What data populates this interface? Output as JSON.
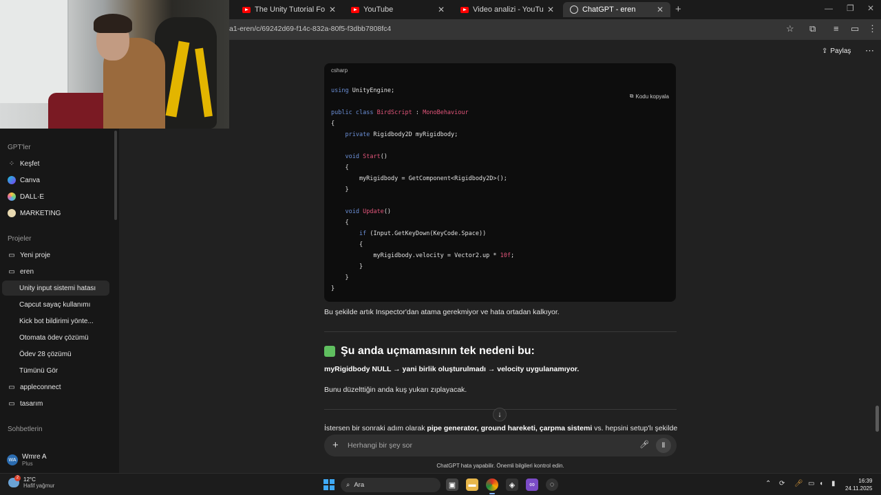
{
  "browser": {
    "tabs": [
      {
        "title": "The Unity Tutorial For Complete",
        "icon": "youtube-icon"
      },
      {
        "title": "YouTube",
        "icon": "youtube-icon"
      },
      {
        "title": "Video analizi - YouTube Studio",
        "icon": "youtube-icon"
      },
      {
        "title": "ChatGPT - eren",
        "icon": "chatgpt-icon"
      }
    ],
    "url": "a1-eren/c/69242d69-f14c-832a-80f5-f3dbb7808fc4"
  },
  "sidebar": {
    "gpts_title": "GPT'ler",
    "gpts": [
      {
        "label": "Keşfet"
      },
      {
        "label": "Canva"
      },
      {
        "label": "DALL·E"
      },
      {
        "label": "MARKETING"
      }
    ],
    "projects_title": "Projeler",
    "projects": [
      {
        "label": "Yeni proje"
      },
      {
        "label": "eren"
      },
      {
        "label": "Unity input sistemi hatası"
      },
      {
        "label": "Capcut sayaç kullanımı"
      },
      {
        "label": "Kick bot bildirimi yönte..."
      },
      {
        "label": "Otomata ödev çözümü"
      },
      {
        "label": "Ödev 28 çözümü"
      },
      {
        "label": "Tümünü Gör"
      },
      {
        "label": "appleconnect"
      },
      {
        "label": "tasarım"
      }
    ],
    "chats_title": "Sohbetlerin",
    "profile": {
      "initials": "WA",
      "name": "Wmre A",
      "plan": "Plus"
    }
  },
  "header": {
    "share_label": "Paylaş"
  },
  "code": {
    "language": "csharp",
    "copy_label": "Kodu kopyala",
    "lines": [
      {
        "parts": [
          {
            "t": "using",
            "c": "kw"
          },
          {
            "t": " UnityEngine;",
            "c": ""
          }
        ]
      },
      {
        "parts": []
      },
      {
        "parts": [
          {
            "t": "public",
            "c": "kw"
          },
          {
            "t": " ",
            "c": ""
          },
          {
            "t": "class",
            "c": "kw"
          },
          {
            "t": " ",
            "c": ""
          },
          {
            "t": "BirdScript",
            "c": "cls"
          },
          {
            "t": " : ",
            "c": ""
          },
          {
            "t": "MonoBehaviour",
            "c": "cls"
          }
        ]
      },
      {
        "parts": [
          {
            "t": "{",
            "c": ""
          }
        ]
      },
      {
        "parts": [
          {
            "t": "    ",
            "c": ""
          },
          {
            "t": "private",
            "c": "kw"
          },
          {
            "t": " Rigidbody2D myRigidbody;",
            "c": ""
          }
        ]
      },
      {
        "parts": []
      },
      {
        "parts": [
          {
            "t": "    ",
            "c": ""
          },
          {
            "t": "void",
            "c": "kw"
          },
          {
            "t": " ",
            "c": ""
          },
          {
            "t": "Start",
            "c": "cls"
          },
          {
            "t": "()",
            "c": ""
          }
        ]
      },
      {
        "parts": [
          {
            "t": "    {",
            "c": ""
          }
        ]
      },
      {
        "parts": [
          {
            "t": "        myRigidbody = GetComponent<Rigidbody2D>();",
            "c": ""
          }
        ]
      },
      {
        "parts": [
          {
            "t": "    }",
            "c": ""
          }
        ]
      },
      {
        "parts": []
      },
      {
        "parts": [
          {
            "t": "    ",
            "c": ""
          },
          {
            "t": "void",
            "c": "kw"
          },
          {
            "t": " ",
            "c": ""
          },
          {
            "t": "Update",
            "c": "cls"
          },
          {
            "t": "()",
            "c": ""
          }
        ]
      },
      {
        "parts": [
          {
            "t": "    {",
            "c": ""
          }
        ]
      },
      {
        "parts": [
          {
            "t": "        ",
            "c": ""
          },
          {
            "t": "if",
            "c": "kw"
          },
          {
            "t": " (Input.GetKeyDown(KeyCode.Space))",
            "c": ""
          }
        ]
      },
      {
        "parts": [
          {
            "t": "        {",
            "c": ""
          }
        ]
      },
      {
        "parts": [
          {
            "t": "            myRigidbody.velocity = Vector2.up * ",
            "c": ""
          },
          {
            "t": "10f",
            "c": "num"
          },
          {
            "t": ";",
            "c": ""
          }
        ]
      },
      {
        "parts": [
          {
            "t": "        }",
            "c": ""
          }
        ]
      },
      {
        "parts": [
          {
            "t": "    }",
            "c": ""
          }
        ]
      },
      {
        "parts": [
          {
            "t": "}",
            "c": ""
          }
        ]
      }
    ]
  },
  "content": {
    "after_code": "Bu şekilde artık Inspector'dan atama gerekmiyor ve hata ortadan kalkıyor.",
    "heading": "Şu anda uçmamasının tek nedeni bu:",
    "bold_line": "myRigidbody NULL → yani birlik oluşturulmadı → velocity uygulanamıyor.",
    "fix_line": "Bunu düzelttiğin anda kuş yukarı zıplayacak.",
    "next_prefix": "İstersen bir sonraki adım olarak ",
    "next_b1": "pipe generator, ground hareketi, çarpma sistemi",
    "next_suffix": " vs. hepsini setup'lı şekilde"
  },
  "composer": {
    "placeholder": "Herhangi bir şey sor",
    "disclaimer": "ChatGPT hata yapabilir. Önemli bilgileri kontrol edin."
  },
  "taskbar": {
    "weather_temp": "12°C",
    "weather_desc": "Hafif yağmur",
    "weather_badge": "2",
    "search_label": "Ara",
    "time": "16:39",
    "date": "24.11.2025"
  },
  "colors": {
    "keyword": "#6b8fd6",
    "classname": "#e2557a",
    "accent_green": "#5fbf5f"
  }
}
